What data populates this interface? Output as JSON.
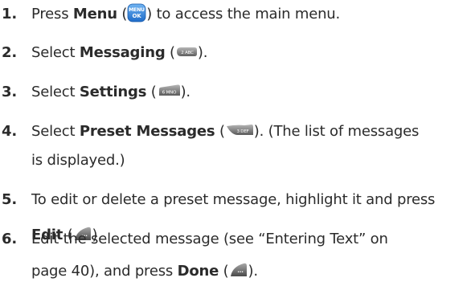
{
  "steps": [
    {
      "num": "1.",
      "pre": "Press ",
      "bold": "Menu",
      "open": " (",
      "icon": "menu-ok-key-icon",
      "icon_text_top": "MENU",
      "icon_text_bottom": "OK",
      "post": ") to access the main menu."
    },
    {
      "num": "2.",
      "pre": "Select ",
      "bold": "Messaging",
      "open": " (",
      "icon": "key-2-abc-icon",
      "icon_text": "2 ABC",
      "post": ")."
    },
    {
      "num": "3.",
      "pre": "Select ",
      "bold": "Settings",
      "open": " (",
      "icon": "key-6-mno-icon",
      "icon_text": "6 MNO",
      "post": ")."
    },
    {
      "num": "4.",
      "pre": "Select ",
      "bold": "Preset Messages",
      "open": " (",
      "icon": "key-3-def-icon",
      "icon_text": "3 DEF",
      "post": "). (The list of messages",
      "line2": "is displayed.)"
    },
    {
      "num": "5.",
      "line1": "To edit or delete a preset message, highlight it and press",
      "bold": "Edit",
      "open": " (",
      "icon": "left-softkey-icon",
      "icon_text": "...",
      "post": ")."
    },
    {
      "num": "6.",
      "line1": "Edit the selected message (see “Entering Text” on",
      "pre": "page 40), and press ",
      "bold": "Done",
      "open": " (",
      "icon": "left-softkey-icon",
      "icon_text": "...",
      "post": ")."
    }
  ],
  "colors": {
    "text": "#2b2b2b",
    "menu_key_blue": "#2f7fd8",
    "key_gray": "#8a8a8a"
  }
}
